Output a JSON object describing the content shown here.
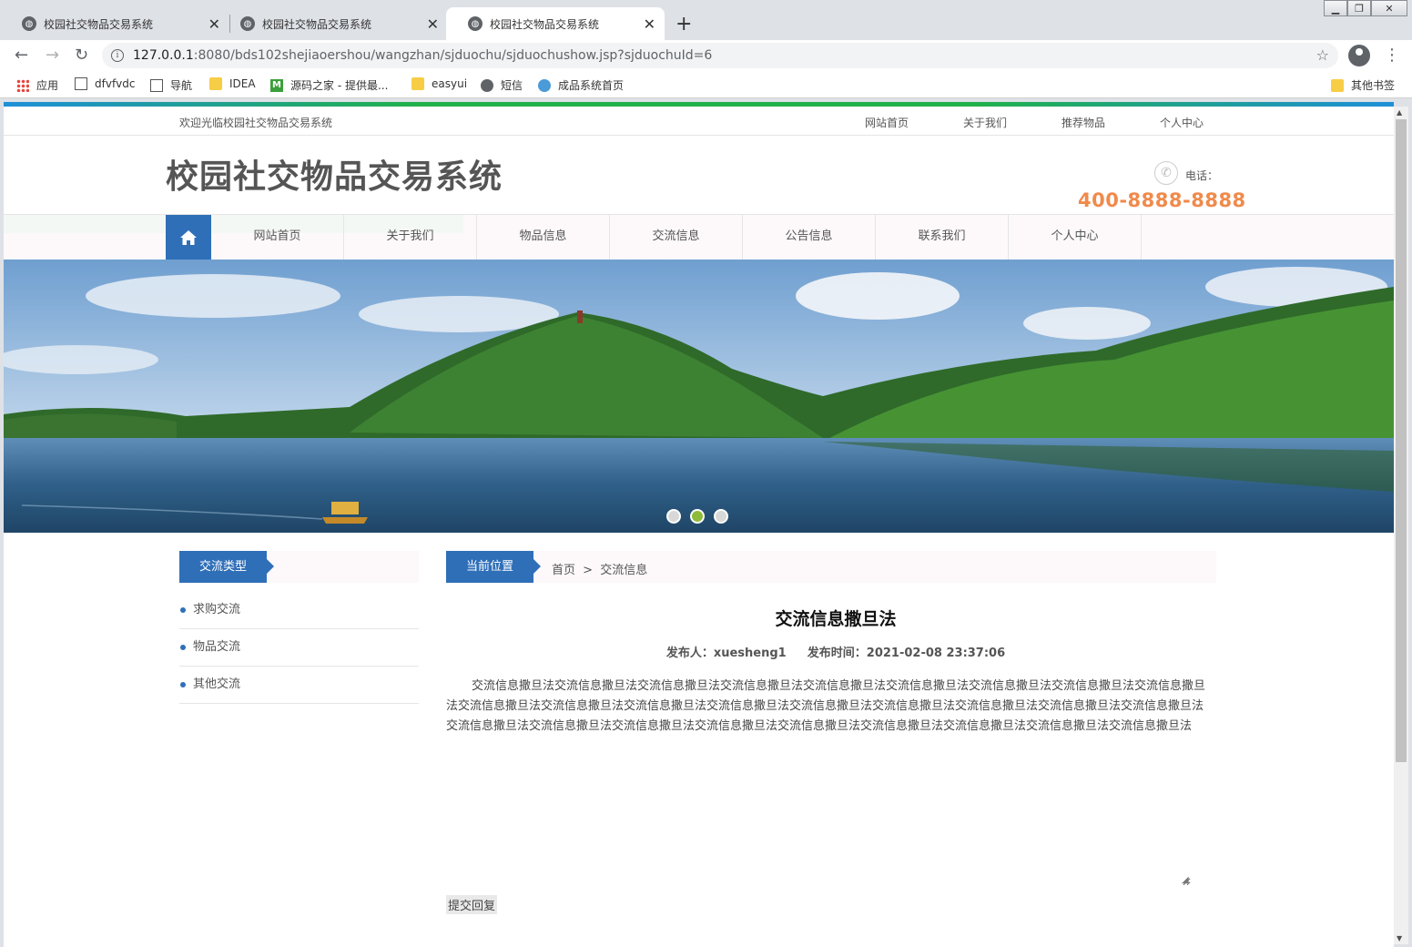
{
  "browser": {
    "tabs": [
      {
        "title": "校园社交物品交易系统"
      },
      {
        "title": "校园社交物品交易系统"
      },
      {
        "title": "校园社交物品交易系统"
      }
    ],
    "url_host": "127.0.0.1",
    "url_path": ":8080/bds102shejiaoershou/wangzhan/sjduochu/sjduochushow.jsp?sjduochuId=6",
    "bookmarks": [
      "应用",
      "dfvfvdc",
      "导航",
      "IDEA",
      "源码之家 - 提供最...",
      "easyui",
      "短信",
      "成品系统首页"
    ],
    "other_bookmarks": "其他书签"
  },
  "site": {
    "welcome": "欢迎光临校园社交物品交易系统",
    "top_links": [
      "网站首页",
      "关于我们",
      "推荐物品",
      "个人中心"
    ],
    "title": "校园社交物品交易系统",
    "phone_label": "电话：",
    "phone_number": "400-8888-8888",
    "nav": [
      "网站首页",
      "关于我们",
      "物品信息",
      "交流信息",
      "公告信息",
      "联系我们",
      "个人中心"
    ],
    "accent_color": "#2f6fb8",
    "phone_color": "#f08a4b"
  },
  "sidebar": {
    "heading": "交流类型",
    "items": [
      "求购交流",
      "物品交流",
      "其他交流"
    ]
  },
  "main": {
    "location_label": "当前位置",
    "crumb_home": "首页",
    "crumb_sep": ">",
    "crumb_current": "交流信息",
    "article_title": "交流信息撒旦法",
    "author_label": "发布人：",
    "author": "xuesheng1",
    "time_label": "发布时间：",
    "time": "2021-02-08 23:37:06",
    "body": "交流信息撒旦法交流信息撒旦法交流信息撒旦法交流信息撒旦法交流信息撒旦法交流信息撒旦法交流信息撒旦法交流信息撒旦法交流信息撒旦法交流信息撒旦法交流信息撒旦法交流信息撒旦法交流信息撒旦法交流信息撒旦法交流信息撒旦法交流信息撒旦法交流信息撒旦法交流信息撒旦法交流信息撒旦法交流信息撒旦法交流信息撒旦法交流信息撒旦法交流信息撒旦法交流信息撒旦法交流信息撒旦法交流信息撒旦法交流信息撒旦法",
    "submit_label": "提交回复"
  }
}
